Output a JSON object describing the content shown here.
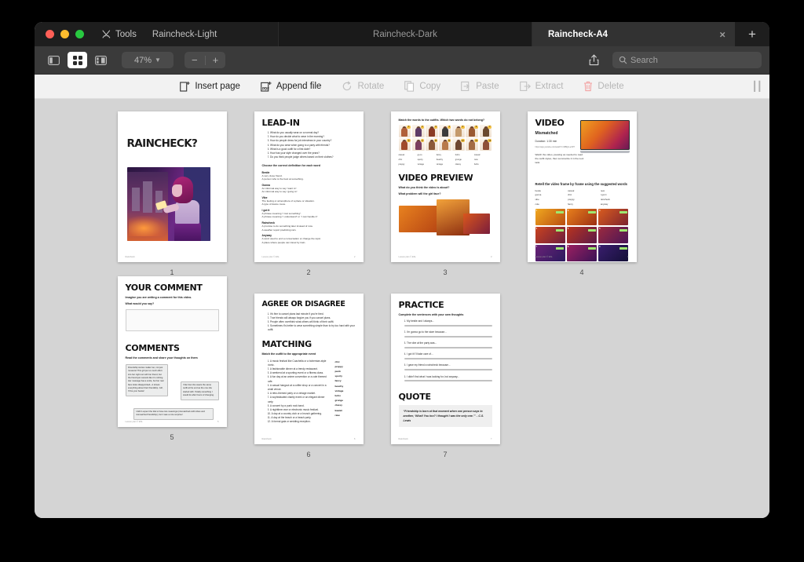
{
  "window": {
    "tabs": [
      {
        "label": "Raincheck-Light",
        "active": false
      },
      {
        "label": "Raincheck-Dark",
        "active": false
      },
      {
        "label": "Raincheck-A4",
        "active": true
      }
    ],
    "tools_label": "Tools",
    "new_tab_label": "+",
    "close_label": "×"
  },
  "toolbar": {
    "sidebar_icon": "sidebar-icon",
    "grid_icon": "grid-view-icon",
    "spread_icon": "two-page-view-icon",
    "zoom_level": "47%",
    "zoom_out": "−",
    "zoom_in": "+",
    "share_icon": "share-icon",
    "search_placeholder": "Search",
    "search_value": ""
  },
  "actions": [
    {
      "label": "Insert page",
      "icon": "insert-page-icon",
      "enabled": true
    },
    {
      "label": "Append file",
      "icon": "append-file-icon",
      "enabled": true
    },
    {
      "label": "Rotate",
      "icon": "rotate-icon",
      "enabled": false
    },
    {
      "label": "Copy",
      "icon": "copy-icon",
      "enabled": false
    },
    {
      "label": "Paste",
      "icon": "paste-icon",
      "enabled": false
    },
    {
      "label": "Extract",
      "icon": "extract-icon",
      "enabled": false
    },
    {
      "label": "Delete",
      "icon": "trash-icon",
      "enabled": false
    }
  ],
  "pages": [
    {
      "number": "1",
      "title": "RAINCHECK?",
      "footer_left": "Raincheck",
      "footer_right": ""
    },
    {
      "number": "2",
      "title": "LEAD-IN",
      "questions": [
        "What do you usually wear on a normal day?",
        "How do you decide what to wear in the morning?",
        "How do people dress for job interviews in your country?",
        "What do you wear when going to a party with friends?",
        "What is a good outfit for a first date?",
        "How has your style changed over the years?",
        "Do you think people judge others based on their clothes?"
      ],
      "definitions_heading": "Choose the correct definition for each word",
      "definitions": [
        {
          "word": "Bestie",
          "a": "A very close friend.",
          "b": "A person who is the best at something."
        },
        {
          "word": "Gonna",
          "a": "An informal way to say “want to”.",
          "b": "An informal way to say “going to”."
        },
        {
          "word": "Vibe",
          "a": "The feeling or atmosphere of a place or situation.",
          "b": "A type of dance move."
        },
        {
          "word": "I got it",
          "a": "A phrase meaning “I lost something”.",
          "b": "A phrase meaning “I understand” or “I can handle it”."
        },
        {
          "word": "Raincheck",
          "a": "A promise to do something later instead of now.",
          "b": "A weather report predicting rain."
        },
        {
          "word": "Anyway",
          "a": "A word used to end a conversation or change the topic.",
          "b": "A place where people can travel by train."
        }
      ],
      "footer_left": "Lesson plan © ESL",
      "footer_right": "2"
    },
    {
      "number": "3",
      "instruction": "Match the words to the outfits. Which two words do not belong?",
      "characters": [
        "1",
        "2",
        "3",
        "4",
        "5",
        "6",
        "7",
        "8",
        "9",
        "10",
        "11",
        "12",
        "13",
        "14"
      ],
      "word_options": [
        "casual",
        "go-to",
        "fancy",
        "boho",
        "casual",
        "chic",
        "sporty",
        "beachy",
        "grunge",
        "new",
        "preppy",
        "vintage",
        "vintage",
        "classy",
        "boho"
      ],
      "video_preview_title": "VIDEO PREVIEW",
      "video_preview_q1": "What do you think the video is about?",
      "video_preview_q2": "What problem will the girl face?",
      "footer_left": "Lesson plan © ESL",
      "footer_right": "3"
    },
    {
      "number": "4",
      "title": "VIDEO",
      "video_name": "Mismatched",
      "duration_label": "Duration: 1:30 min",
      "link_note": "https://app.youtube.com/watch?v=MBQxLeVRT",
      "instruction": "Watch the video, pausing as needed to read the outfit styles, then summarize it in the next task.",
      "retell_heading": "Retell the video frame by frame using the suggested words",
      "words": [
        "bestie",
        "casual",
        "new",
        "gonna",
        "chic",
        "I got it",
        "vibe",
        "preppy",
        "raincheck",
        "cute",
        "fancy",
        "anyway"
      ],
      "frames": [
        "1",
        "2",
        "3",
        "4",
        "5",
        "6",
        "7",
        "8",
        "9"
      ],
      "footer_left": "Lesson plan © ESL",
      "footer_right": "4"
    },
    {
      "number": "5",
      "title": "YOUR COMMENT",
      "prompt_line1": "Imagine you are writing a comment for this video.",
      "prompt_line2": "What would you say?",
      "comments_title": "COMMENTS",
      "comments_sub": "Read the comments and share your thoughts on them",
      "comments": [
        "Friendship stories matter too, not just romance! This girl put so much effort into her night out with her friend, but the friend just cancels like it's nothing. Her message has a smile, but her real face looks disappointed—it shows everything about their friendship. Girl, I'll be your bestie!",
        "I like how she wears the same outfit at the end as the one she started with. Totally something I would do after hours of changing.",
        "I didn't expect the title to have two meanings (mismatched outfit vibes and mismatched friendship), but it was a nice surprise!"
      ],
      "footer_left": "Lesson plan © ESL",
      "footer_right": "5"
    },
    {
      "number": "6",
      "title": "AGREE OR DISAGREE",
      "statements": [
        "It's fine to cancel plans last minute if you're tired.",
        "True friends will always forgive you if you cancel plans.",
        "People often overthink what others will think of their outfit.",
        "Sometimes it's better to wear something simple than to try too hard with your outfit."
      ],
      "matching_title": "MATCHING",
      "matching_sub": "Match the outfit to the appropriate event",
      "events": [
        "A music festival like Coachella or a bohemian-style picnic.",
        "A fashionable dinner at a trendy restaurant.",
        "A weekend at a sporting event or a fitness class.",
        "A fun day at an anime convention or a cute themed cafe.",
        "A casual hangout at a coffee shop or a concert in a small venue.",
        "A retro-themed party or a vintage market.",
        "A sophisticated charity event or an elegant dinner party.",
        "A concert by a punk rock band.",
        "A nighttime rave or electronic music festival.",
        "A day at a country club or a brunch gathering.",
        "A day at the beach or a beach party.",
        "A formal gala or wedding reception."
      ],
      "words": [
        "chic",
        "preppy",
        "punk",
        "sporty",
        "fancy",
        "beachy",
        "vintage",
        "boho",
        "grunge",
        "classy",
        "kawaii",
        "rave"
      ],
      "footer_left": "Raincheck",
      "footer_right": "6"
    },
    {
      "number": "7",
      "title": "PRACTICE",
      "sub": "Complete the sentences with your own thoughts",
      "items": [
        "My bestie and I always...",
        "I'm gonna go to the store because...",
        "The vibe at the party was...",
        "I got it! I'll take care of...",
        "I gave my friend a raincheck because...",
        "I didn't find what I was looking for, but anyway..."
      ],
      "quote_title": "QUOTE",
      "quote_text": "“Friendship is born at that moment when one person says to another, ‘What! You too? I thought I was the only one.’” – C.S. Lewis",
      "footer_left": "Raincheck",
      "footer_right": "7"
    }
  ],
  "colors": {
    "titlebar": "#1e1e1e",
    "toolbar": "#3a3a3a",
    "active_tab": "#323232",
    "actionbar": "#f2f2f2",
    "canvas": "#d4d4d4",
    "delete_red": "#f08a8a",
    "traffic_red": "#ff5f57",
    "traffic_yellow": "#febc2e",
    "traffic_green": "#28c840"
  }
}
